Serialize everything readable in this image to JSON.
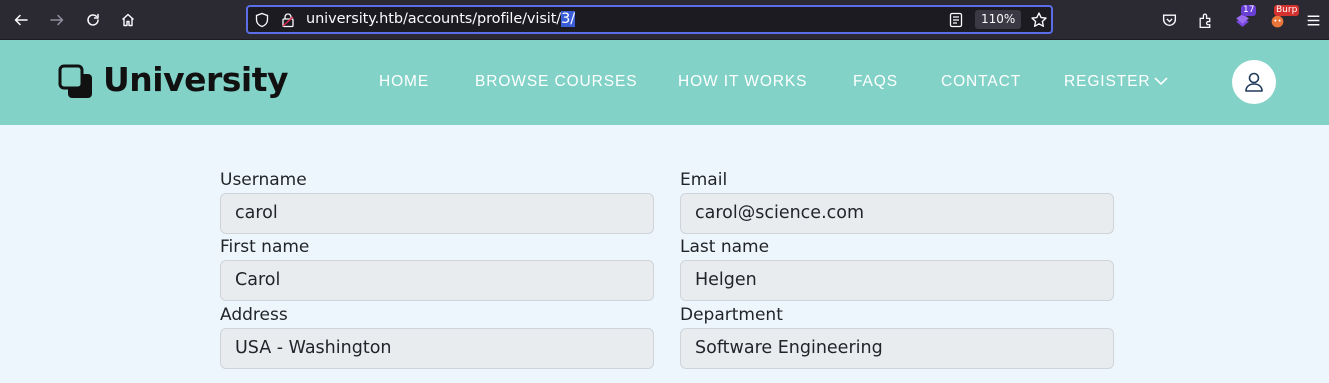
{
  "browser": {
    "url_prefix": "university.htb/accounts/profile/visit/",
    "url_selected": "3/",
    "zoom": "110%",
    "extension_badge_count": "17",
    "extension_badge_label": "Burp",
    "icons": [
      "back-icon",
      "forward-icon",
      "reload-icon",
      "home-icon",
      "shield-icon",
      "lock-icon",
      "reader-view-icon",
      "bookmark-star-icon",
      "pocket-icon",
      "extensions-icon",
      "menu-icon"
    ]
  },
  "site": {
    "brand": "University",
    "nav": {
      "home": "HOME",
      "browse_courses": "BROWSE COURSES",
      "how_it_works": "HOW IT WORKS",
      "faqs": "FAQS",
      "contact": "CONTACT",
      "register": "REGISTER"
    },
    "header_color": "#82d2c8"
  },
  "profile": {
    "username_label": "Username",
    "username_value": "carol",
    "email_label": "Email",
    "email_value": "carol@science.com",
    "first_name_label": "First name",
    "first_name_value": "Carol",
    "last_name_label": "Last name",
    "last_name_value": "Helgen",
    "address_label": "Address",
    "address_value": "USA - Washington",
    "department_label": "Department",
    "department_value": "Software Engineering"
  }
}
